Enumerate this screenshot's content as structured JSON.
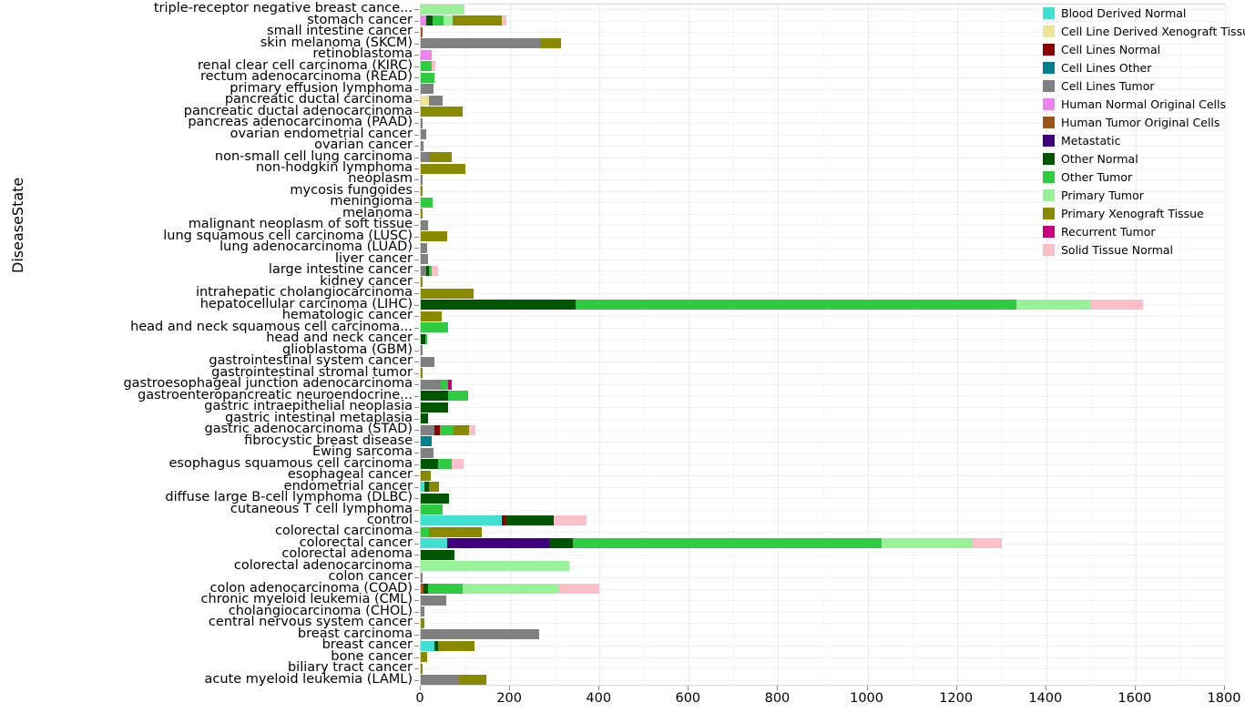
{
  "axes": {
    "y_title": "DiseaseState",
    "x_ticks": [
      "0",
      "200",
      "400",
      "600",
      "800",
      "1000",
      "1200",
      "1400",
      "1600",
      "1800"
    ]
  },
  "legend": {
    "title": "",
    "items": [
      {
        "label": "Blood Derived Normal",
        "color": "#3FE0D0"
      },
      {
        "label": "Cell Line Derived Xenograft Tissue",
        "color": "#EDE49B"
      },
      {
        "label": "Cell Lines Normal",
        "color": "#8B0000"
      },
      {
        "label": "Cell Lines Other",
        "color": "#00808C"
      },
      {
        "label": "Cell Lines Tumor",
        "color": "#808080"
      },
      {
        "label": "Human Normal Original Cells",
        "color": "#EE82EE"
      },
      {
        "label": "Human Tumor Original Cells",
        "color": "#9C5418"
      },
      {
        "label": "Metastatic",
        "color": "#40007F"
      },
      {
        "label": "Other Normal",
        "color": "#005500"
      },
      {
        "label": "Other Tumor",
        "color": "#2ECC40"
      },
      {
        "label": "Primary Tumor",
        "color": "#99F297"
      },
      {
        "label": "Primary Xenograft Tissue",
        "color": "#8A8A00"
      },
      {
        "label": "Recurrent Tumor",
        "color": "#C8007F"
      },
      {
        "label": "Solid Tissue Normal",
        "color": "#FBBFC9"
      }
    ]
  },
  "chart_data": {
    "type": "bar",
    "orientation": "horizontal",
    "stacked": true,
    "title": "",
    "xlabel": "",
    "ylabel": "DiseaseState",
    "xlim": [
      0,
      1800
    ],
    "grid": true,
    "legend_position": "right",
    "series_names": [
      "Blood Derived Normal",
      "Cell Line Derived Xenograft Tissue",
      "Cell Lines Normal",
      "Cell Lines Other",
      "Cell Lines Tumor",
      "Human Normal Original Cells",
      "Human Tumor Original Cells",
      "Metastatic",
      "Other Normal",
      "Other Tumor",
      "Primary Tumor",
      "Primary Xenograft Tissue",
      "Recurrent Tumor",
      "Solid Tissue Normal"
    ],
    "categories": [
      "triple-receptor negative breast cance...",
      "stomach cancer",
      "small intestine cancer",
      "skin melanoma (SKCM)",
      "retinoblastoma",
      "renal clear cell carcinoma (KIRC)",
      "rectum adenocarcinoma (READ)",
      "primary effusion lymphoma",
      "pancreatic ductal carcinoma",
      "pancreatic ductal adenocarcinoma",
      "pancreas adenocarcinoma (PAAD)",
      "ovarian endometrial cancer",
      "ovarian cancer",
      "non-small cell lung carcinoma",
      "non-hodgkin lymphoma",
      "neoplasm",
      "mycosis fungoides",
      "meningioma",
      "melanoma",
      "malignant neoplasm of soft tissue",
      "lung squamous cell carcinoma (LUSC)",
      "lung adenocarcinoma (LUAD)",
      "liver cancer",
      "large intestine cancer",
      "kidney cancer",
      "intrahepatic cholangiocarcinoma",
      "hepatocellular carcinoma (LIHC)",
      "hematologic cancer",
      "head and neck squamous cell carcinoma...",
      "head and neck cancer",
      "glioblastoma (GBM)",
      "gastrointestinal system cancer",
      "gastrointestinal stromal tumor",
      "gastroesophageal junction adenocarcinoma",
      "gastroenteropancreatic neuroendocrine...",
      "gastric intraepithelial neoplasia",
      "gastric intestinal metaplasia",
      "gastric adenocarcinoma (STAD)",
      "fibrocystic breast disease",
      "Ewing sarcoma",
      "esophagus squamous cell carcinoma",
      "esophageal cancer",
      "endometrial cancer",
      "diffuse large B-cell lymphoma (DLBC)",
      "cutaneous T cell lymphoma",
      "control",
      "colorectal carcinoma",
      "colorectal cancer",
      "colorectal adenoma",
      "colorectal adenocarcinoma",
      "colon cancer",
      "colon adenocarcinoma (COAD)",
      "chronic myeloid leukemia (CML)",
      "cholangiocarcinoma (CHOL)",
      "central nervous system cancer",
      "breast carcinoma",
      "breast cancer",
      "bone cancer",
      "biliary tract cancer",
      "acute myeloid leukemia (LAML)"
    ],
    "rows": [
      {
        "category": "triple-receptor negative breast cance...",
        "segments": [
          [
            "Primary Tumor",
            98
          ]
        ]
      },
      {
        "category": "stomach cancer",
        "segments": [
          [
            "Human Normal Original Cells",
            13
          ],
          [
            "Other Normal",
            14
          ],
          [
            "Other Tumor",
            24
          ],
          [
            "Primary Tumor",
            20
          ],
          [
            "Primary Xenograft Tissue",
            111
          ],
          [
            "Solid Tissue Normal",
            10
          ]
        ]
      },
      {
        "category": "small intestine cancer",
        "segments": [
          [
            "Human Tumor Original Cells",
            3
          ]
        ]
      },
      {
        "category": "skin melanoma (SKCM)",
        "segments": [
          [
            "Cell Lines Tumor",
            268
          ],
          [
            "Primary Xenograft Tissue",
            46
          ]
        ]
      },
      {
        "category": "retinoblastoma",
        "segments": [
          [
            "Human Normal Original Cells",
            24
          ]
        ]
      },
      {
        "category": "renal clear cell carcinoma (KIRC)",
        "segments": [
          [
            "Other Tumor",
            24
          ],
          [
            "Solid Tissue Normal",
            8
          ]
        ]
      },
      {
        "category": "rectum adenocarcinoma (READ)",
        "segments": [
          [
            "Other Tumor",
            31
          ]
        ]
      },
      {
        "category": "primary effusion lymphoma",
        "segments": [
          [
            "Cell Lines Tumor",
            28
          ]
        ]
      },
      {
        "category": "pancreatic ductal carcinoma",
        "segments": [
          [
            "Cell Line Derived Xenograft Tissue",
            19
          ],
          [
            "Cell Lines Tumor",
            30
          ]
        ]
      },
      {
        "category": "pancreatic ductal adenocarcinoma",
        "segments": [
          [
            "Primary Xenograft Tissue",
            93
          ]
        ]
      },
      {
        "category": "pancreas adenocarcinoma (PAAD)",
        "segments": [
          [
            "Cell Lines Tumor",
            5
          ]
        ]
      },
      {
        "category": "ovarian endometrial cancer",
        "segments": [
          [
            "Cell Lines Tumor",
            12
          ]
        ]
      },
      {
        "category": "ovarian cancer",
        "segments": [
          [
            "Cell Lines Tumor",
            6
          ]
        ]
      },
      {
        "category": "non-small cell lung carcinoma",
        "segments": [
          [
            "Cell Lines Tumor",
            18
          ],
          [
            "Primary Xenograft Tissue",
            52
          ]
        ]
      },
      {
        "category": "non-hodgkin lymphoma",
        "segments": [
          [
            "Primary Xenograft Tissue",
            99
          ]
        ]
      },
      {
        "category": "neoplasm",
        "segments": [
          [
            "Cell Lines Tumor",
            3
          ]
        ]
      },
      {
        "category": "mycosis fungoides",
        "segments": [
          [
            "Primary Xenograft Tissue",
            3
          ]
        ]
      },
      {
        "category": "meningioma",
        "segments": [
          [
            "Other Tumor",
            26
          ]
        ]
      },
      {
        "category": "melanoma",
        "segments": [
          [
            "Primary Xenograft Tissue",
            3
          ]
        ]
      },
      {
        "category": "malignant neoplasm of soft tissue",
        "segments": [
          [
            "Cell Lines Tumor",
            17
          ]
        ]
      },
      {
        "category": "lung squamous cell carcinoma (LUSC)",
        "segments": [
          [
            "Primary Xenograft Tissue",
            60
          ]
        ]
      },
      {
        "category": "lung adenocarcinoma (LUAD)",
        "segments": [
          [
            "Cell Lines Tumor",
            14
          ]
        ]
      },
      {
        "category": "liver cancer",
        "segments": [
          [
            "Cell Lines Tumor",
            16
          ]
        ]
      },
      {
        "category": "large intestine cancer",
        "segments": [
          [
            "Cell Lines Tumor",
            12
          ],
          [
            "Other Normal",
            7
          ],
          [
            "Other Tumor",
            5
          ],
          [
            "Solid Tissue Normal",
            14
          ]
        ]
      },
      {
        "category": "kidney cancer",
        "segments": [
          [
            "Primary Xenograft Tissue",
            5
          ]
        ]
      },
      {
        "category": "intrahepatic cholangiocarcinoma",
        "segments": [
          [
            "Primary Xenograft Tissue",
            119
          ]
        ]
      },
      {
        "category": "hepatocellular carcinoma (LIHC)",
        "segments": [
          [
            "Other Normal",
            346
          ],
          [
            "Other Tumor",
            987
          ],
          [
            "Primary Tumor",
            165
          ],
          [
            "Solid Tissue Normal",
            118
          ]
        ]
      },
      {
        "category": "hematologic cancer",
        "segments": [
          [
            "Primary Xenograft Tissue",
            47
          ]
        ]
      },
      {
        "category": "head and neck squamous cell carcinoma...",
        "segments": [
          [
            "Other Tumor",
            62
          ]
        ]
      },
      {
        "category": "head and neck cancer",
        "segments": [
          [
            "Other Normal",
            10
          ],
          [
            "Other Tumor",
            4
          ]
        ]
      },
      {
        "category": "glioblastoma (GBM)",
        "segments": [
          [
            "Cell Lines Tumor",
            5
          ]
        ]
      },
      {
        "category": "gastrointestinal system cancer",
        "segments": [
          [
            "Cell Lines Tumor",
            31
          ]
        ]
      },
      {
        "category": "gastrointestinal stromal tumor",
        "segments": [
          [
            "Primary Xenograft Tissue",
            5
          ]
        ]
      },
      {
        "category": "gastroesophageal junction adenocarcinoma",
        "segments": [
          [
            "Cell Lines Tumor",
            45
          ],
          [
            "Other Tumor",
            16
          ],
          [
            "Recurrent Tumor",
            8
          ]
        ]
      },
      {
        "category": "gastroenteropancreatic neuroendocrine...",
        "segments": [
          [
            "Other Normal",
            62
          ],
          [
            "Other Tumor",
            43
          ]
        ]
      },
      {
        "category": "gastric intraepithelial neoplasia",
        "segments": [
          [
            "Other Normal",
            62
          ]
        ]
      },
      {
        "category": "gastric intestinal metaplasia",
        "segments": [
          [
            "Other Normal",
            16
          ]
        ]
      },
      {
        "category": "gastric adenocarcinoma (STAD)",
        "segments": [
          [
            "Cell Lines Tumor",
            30
          ],
          [
            "Cell Lines Normal",
            12
          ],
          [
            "Other Tumor",
            32
          ],
          [
            "Primary Xenograft Tissue",
            35
          ],
          [
            "Solid Tissue Normal",
            14
          ]
        ]
      },
      {
        "category": "fibrocystic breast disease",
        "segments": [
          [
            "Cell Lines Other",
            25
          ]
        ]
      },
      {
        "category": "Ewing sarcoma",
        "segments": [
          [
            "Cell Lines Tumor",
            28
          ]
        ]
      },
      {
        "category": "esophagus squamous cell carcinoma",
        "segments": [
          [
            "Other Normal",
            39
          ],
          [
            "Other Tumor",
            31
          ],
          [
            "Solid Tissue Normal",
            26
          ]
        ]
      },
      {
        "category": "esophageal cancer",
        "segments": [
          [
            "Primary Xenograft Tissue",
            22
          ]
        ]
      },
      {
        "category": "endometrial cancer",
        "segments": [
          [
            "Blood Derived Normal",
            9
          ],
          [
            "Other Normal",
            9
          ],
          [
            "Primary Xenograft Tissue",
            22
          ]
        ]
      },
      {
        "category": "diffuse large B-cell lymphoma (DLBC)",
        "segments": [
          [
            "Other Normal",
            63
          ]
        ]
      },
      {
        "category": "cutaneous T cell lymphoma",
        "segments": [
          [
            "Other Tumor",
            48
          ]
        ]
      },
      {
        "category": "control",
        "segments": [
          [
            "Blood Derived Normal",
            182
          ],
          [
            "Cell Lines Normal",
            7
          ],
          [
            "Other Normal",
            108
          ],
          [
            "Solid Tissue Normal",
            75
          ]
        ]
      },
      {
        "category": "colorectal carcinoma",
        "segments": [
          [
            "Other Tumor",
            18
          ],
          [
            "Primary Xenograft Tissue",
            118
          ]
        ]
      },
      {
        "category": "colorectal cancer",
        "segments": [
          [
            "Blood Derived Normal",
            59
          ],
          [
            "Metastatic",
            228
          ],
          [
            "Other Normal",
            53
          ],
          [
            "Other Tumor",
            691
          ],
          [
            "Primary Tumor",
            204
          ],
          [
            "Solid Tissue Normal",
            65
          ]
        ]
      },
      {
        "category": "colorectal adenoma",
        "segments": [
          [
            "Other Normal",
            75
          ]
        ]
      },
      {
        "category": "colorectal adenocarcinoma",
        "segments": [
          [
            "Primary Tumor",
            332
          ]
        ]
      },
      {
        "category": "colon cancer",
        "segments": [
          [
            "Cell Lines Tumor",
            4
          ]
        ]
      },
      {
        "category": "colon adenocarcinoma (COAD)",
        "segments": [
          [
            "Human Tumor Original Cells",
            6
          ],
          [
            "Other Normal",
            10
          ],
          [
            "Other Tumor",
            78
          ],
          [
            "Primary Tumor",
            215
          ],
          [
            "Solid Tissue Normal",
            90
          ]
        ]
      },
      {
        "category": "chronic myeloid leukemia (CML)",
        "segments": [
          [
            "Cell Lines Tumor",
            58
          ]
        ]
      },
      {
        "category": "cholangiocarcinoma (CHOL)",
        "segments": [
          [
            "Cell Lines Tumor",
            9
          ]
        ]
      },
      {
        "category": "central nervous system cancer",
        "segments": [
          [
            "Primary Xenograft Tissue",
            9
          ]
        ]
      },
      {
        "category": "breast carcinoma",
        "segments": [
          [
            "Cell Lines Tumor",
            266
          ]
        ]
      },
      {
        "category": "breast cancer",
        "segments": [
          [
            "Blood Derived Normal",
            30
          ],
          [
            "Other Normal",
            8
          ],
          [
            "Primary Xenograft Tissue",
            83
          ]
        ]
      },
      {
        "category": "bone cancer",
        "segments": [
          [
            "Primary Xenograft Tissue",
            14
          ]
        ]
      },
      {
        "category": "biliary tract cancer",
        "segments": [
          [
            "Primary Xenograft Tissue",
            3
          ]
        ]
      },
      {
        "category": "acute myeloid leukemia (LAML)",
        "segments": [
          [
            "Cell Lines Tumor",
            85
          ],
          [
            "Primary Xenograft Tissue",
            62
          ]
        ]
      }
    ]
  }
}
